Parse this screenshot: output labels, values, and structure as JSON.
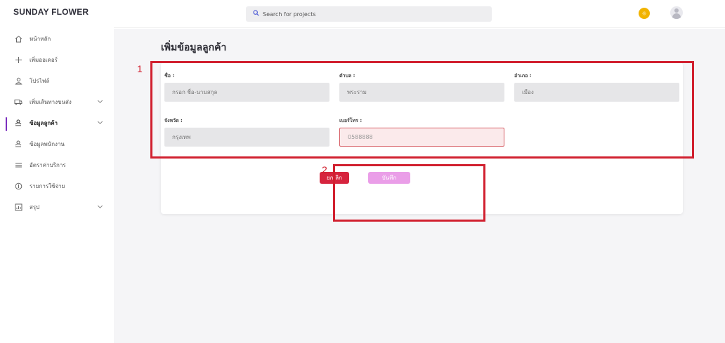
{
  "brand": "SUNDAY FLOWER",
  "search": {
    "placeholder": "Search for projects"
  },
  "sidebar": {
    "items": [
      {
        "label": "หน้าหลัก",
        "icon": "home-icon"
      },
      {
        "label": "เพิ่มออเดอร์",
        "icon": "plus-icon"
      },
      {
        "label": "โปรไฟล์",
        "icon": "user-icon"
      },
      {
        "label": "เพิ่มเส้นทางขนส่ง",
        "icon": "truck-icon"
      },
      {
        "label": "ข้อมูลลูกค้า",
        "icon": "users-icon"
      },
      {
        "label": "ข้อมูลพนักงาน",
        "icon": "users-icon"
      },
      {
        "label": "อัตราค่าบริการ",
        "icon": "list-icon"
      },
      {
        "label": "รายการใช้จ่าย",
        "icon": "money-icon"
      },
      {
        "label": "สรุป",
        "icon": "chart-icon"
      }
    ]
  },
  "page": {
    "title": "เพิ่มข้อมูลลูกค้า"
  },
  "form": {
    "name": {
      "label": "ชื่อ :",
      "placeholder": "กรอก ชื่อ-นามสกุล"
    },
    "subdistrict": {
      "label": "ตำบล :",
      "placeholder": "พระราม"
    },
    "district": {
      "label": "อำเภอ :",
      "placeholder": "เมือง"
    },
    "province": {
      "label": "จังหวัด :",
      "placeholder": "กรุงเทพ"
    },
    "phone": {
      "label": "เบอร์โทร :",
      "value": "0588888"
    }
  },
  "buttons": {
    "cancel": "ยกเลิก",
    "save": "บันทึก"
  },
  "annotations": {
    "one": "1",
    "two": "2"
  },
  "colors": {
    "accent": "#7b2fbe",
    "cancel": "#d6243e",
    "save": "#ea9ee8",
    "annotation": "#d1202f"
  }
}
